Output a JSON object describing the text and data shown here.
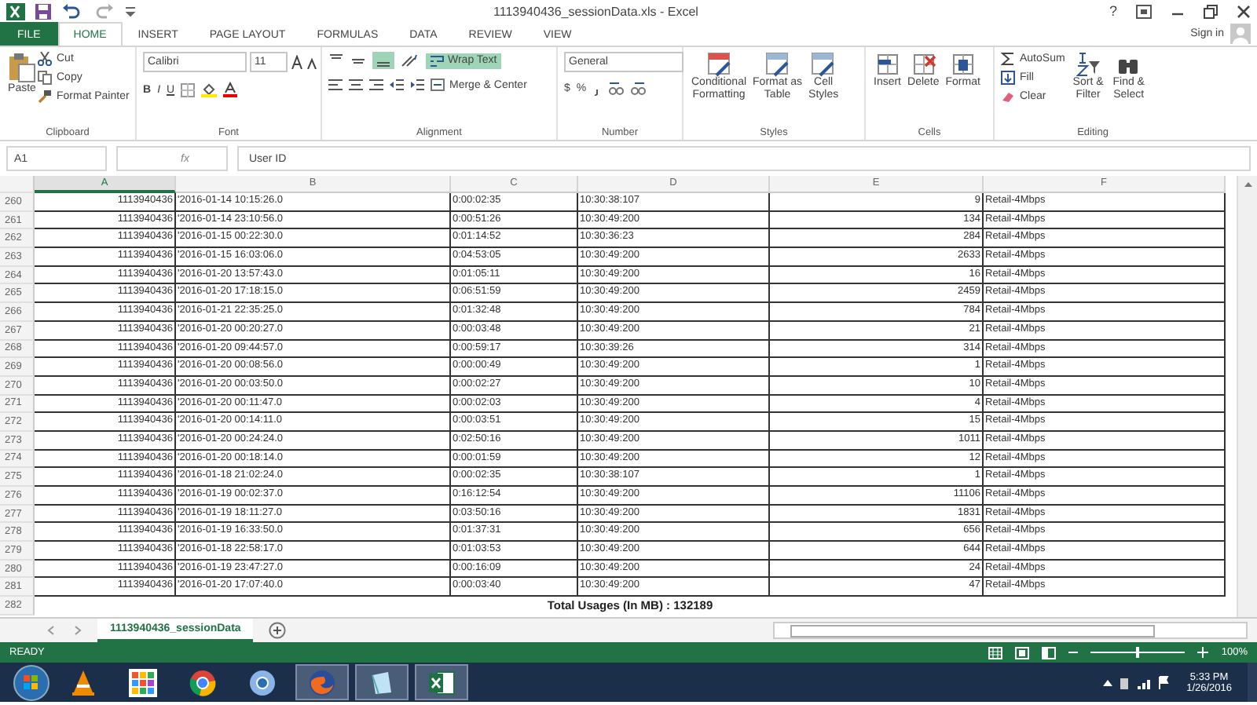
{
  "window": {
    "title": "1113940436_sessionData.xls - Excel",
    "help": "?",
    "sign_in": "Sign in"
  },
  "tabs": [
    {
      "label": "FILE",
      "kind": "file",
      "selected": false
    },
    {
      "label": "HOME",
      "kind": "tab",
      "selected": true
    },
    {
      "label": "INSERT",
      "kind": "tab",
      "selected": false
    },
    {
      "label": "PAGE LAYOUT",
      "kind": "tab",
      "selected": false
    },
    {
      "label": "FORMULAS",
      "kind": "tab",
      "selected": false
    },
    {
      "label": "DATA",
      "kind": "tab",
      "selected": false
    },
    {
      "label": "REVIEW",
      "kind": "tab",
      "selected": false
    },
    {
      "label": "VIEW",
      "kind": "tab",
      "selected": false
    }
  ],
  "ribbon": {
    "clipboard": {
      "label": "Clipboard",
      "paste": "Paste",
      "cut": "Cut",
      "copy": "Copy",
      "format_painter": "Format Painter"
    },
    "font": {
      "label": "Font",
      "name": "Calibri",
      "size": "11",
      "bold": "B",
      "italic": "I",
      "underline": "U"
    },
    "alignment": {
      "label": "Alignment",
      "bottom_align_on": true,
      "wrap_text": {
        "label": "Wrap Text",
        "on": true
      },
      "merge": "Merge & Center"
    },
    "number": {
      "label": "Number",
      "format": "General",
      "currency": "$",
      "percent": "%"
    },
    "styles": {
      "label": "Styles",
      "buttons": [
        [
          "Conditional",
          "Formatting"
        ],
        [
          "Format as",
          "Table"
        ],
        [
          "Cell",
          "Styles"
        ]
      ]
    },
    "cells": {
      "label": "Cells",
      "buttons": [
        "Insert",
        "Delete",
        "Format"
      ]
    },
    "editing": {
      "label": "Editing",
      "autosum": "AutoSum",
      "fill": "Fill",
      "clear": "Clear",
      "buttons": [
        [
          "Sort &",
          "Filter"
        ],
        [
          "Find &",
          "Select"
        ]
      ]
    }
  },
  "formula_bar": {
    "name_box": "A1",
    "fx": "fx",
    "value": "User ID"
  },
  "sheet": {
    "columns": [
      {
        "label": "A",
        "selected": true
      },
      {
        "label": "B",
        "selected": false
      },
      {
        "label": "C",
        "selected": false
      },
      {
        "label": "D",
        "selected": false
      },
      {
        "label": "E",
        "selected": false
      },
      {
        "label": "F",
        "selected": false
      }
    ],
    "rows": [
      {
        "n": "260",
        "cells": [
          "1113940436",
          "'2016-01-14 10:15:26.0",
          "0:00:02:35",
          "10:30:38:107",
          "9",
          "Retail-4Mbps"
        ]
      },
      {
        "n": "261",
        "cells": [
          "1113940436",
          "'2016-01-14 23:10:56.0",
          "0:00:51:26",
          "10:30:49:200",
          "134",
          "Retail-4Mbps"
        ]
      },
      {
        "n": "262",
        "cells": [
          "1113940436",
          "'2016-01-15 00:22:30.0",
          "0:01:14:52",
          "10:30:36:23",
          "284",
          "Retail-4Mbps"
        ]
      },
      {
        "n": "263",
        "cells": [
          "1113940436",
          "'2016-01-15 16:03:06.0",
          "0:04:53:05",
          "10:30:49:200",
          "2633",
          "Retail-4Mbps"
        ]
      },
      {
        "n": "264",
        "cells": [
          "1113940436",
          "'2016-01-20 13:57:43.0",
          "0:01:05:11",
          "10:30:49:200",
          "16",
          "Retail-4Mbps"
        ]
      },
      {
        "n": "265",
        "cells": [
          "1113940436",
          "'2016-01-20 17:18:15.0",
          "0:06:51:59",
          "10:30:49:200",
          "2459",
          "Retail-4Mbps"
        ]
      },
      {
        "n": "266",
        "cells": [
          "1113940436",
          "'2016-01-21 22:35:25.0",
          "0:01:32:48",
          "10:30:49:200",
          "784",
          "Retail-4Mbps"
        ]
      },
      {
        "n": "267",
        "cells": [
          "1113940436",
          "'2016-01-20 00:20:27.0",
          "0:00:03:48",
          "10:30:49:200",
          "21",
          "Retail-4Mbps"
        ]
      },
      {
        "n": "268",
        "cells": [
          "1113940436",
          "'2016-01-20 09:44:57.0",
          "0:00:59:17",
          "10:30:39:26",
          "314",
          "Retail-4Mbps"
        ]
      },
      {
        "n": "269",
        "cells": [
          "1113940436",
          "'2016-01-20 00:08:56.0",
          "0:00:00:49",
          "10:30:49:200",
          "1",
          "Retail-4Mbps"
        ]
      },
      {
        "n": "270",
        "cells": [
          "1113940436",
          "'2016-01-20 00:03:50.0",
          "0:00:02:27",
          "10:30:49:200",
          "10",
          "Retail-4Mbps"
        ]
      },
      {
        "n": "271",
        "cells": [
          "1113940436",
          "'2016-01-20 00:11:47.0",
          "0:00:02:03",
          "10:30:49:200",
          "4",
          "Retail-4Mbps"
        ]
      },
      {
        "n": "272",
        "cells": [
          "1113940436",
          "'2016-01-20 00:14:11.0",
          "0:00:03:51",
          "10:30:49:200",
          "15",
          "Retail-4Mbps"
        ]
      },
      {
        "n": "273",
        "cells": [
          "1113940436",
          "'2016-01-20 00:24:24.0",
          "0:02:50:16",
          "10:30:49:200",
          "1011",
          "Retail-4Mbps"
        ]
      },
      {
        "n": "274",
        "cells": [
          "1113940436",
          "'2016-01-20 00:18:14.0",
          "0:00:01:59",
          "10:30:49:200",
          "12",
          "Retail-4Mbps"
        ]
      },
      {
        "n": "275",
        "cells": [
          "1113940436",
          "'2016-01-18 21:02:24.0",
          "0:00:02:35",
          "10:30:38:107",
          "1",
          "Retail-4Mbps"
        ]
      },
      {
        "n": "276",
        "cells": [
          "1113940436",
          "'2016-01-19 00:02:37.0",
          "0:16:12:54",
          "10:30:49:200",
          "11106",
          "Retail-4Mbps"
        ]
      },
      {
        "n": "277",
        "cells": [
          "1113940436",
          "'2016-01-19 18:11:27.0",
          "0:03:50:16",
          "10:30:49:200",
          "1831",
          "Retail-4Mbps"
        ]
      },
      {
        "n": "278",
        "cells": [
          "1113940436",
          "'2016-01-19 16:33:50.0",
          "0:01:37:31",
          "10:30:49:200",
          "656",
          "Retail-4Mbps"
        ]
      },
      {
        "n": "279",
        "cells": [
          "1113940436",
          "'2016-01-18 22:58:17.0",
          "0:01:03:53",
          "10:30:49:200",
          "644",
          "Retail-4Mbps"
        ]
      },
      {
        "n": "280",
        "cells": [
          "1113940436",
          "'2016-01-19 23:47:27.0",
          "0:00:16:09",
          "10:30:49:200",
          "24",
          "Retail-4Mbps"
        ]
      },
      {
        "n": "281",
        "cells": [
          "1113940436",
          "'2016-01-20 17:07:40.0",
          "0:00:03:40",
          "10:30:49:200",
          "47",
          "Retail-4Mbps"
        ]
      }
    ],
    "total": {
      "n": "282",
      "text": "Total Usages (In MB) : 132189"
    }
  },
  "sheet_tabs": [
    {
      "label": "1113940436_sessionData",
      "selected": true
    }
  ],
  "status_bar": {
    "mode": "READY",
    "zoom": {
      "label": "100%",
      "level": 0.5
    }
  },
  "taskbar": {
    "apps": [
      {
        "kind": "vlc",
        "running": false
      },
      {
        "kind": "grid",
        "running": false
      },
      {
        "kind": "chrome",
        "running": false
      },
      {
        "kind": "chromium",
        "running": false
      },
      {
        "kind": "firefox",
        "running": true
      },
      {
        "kind": "notes",
        "running": true
      },
      {
        "kind": "excel",
        "running": true
      }
    ],
    "time": "5:33 PM",
    "date": "1/26/2016"
  }
}
